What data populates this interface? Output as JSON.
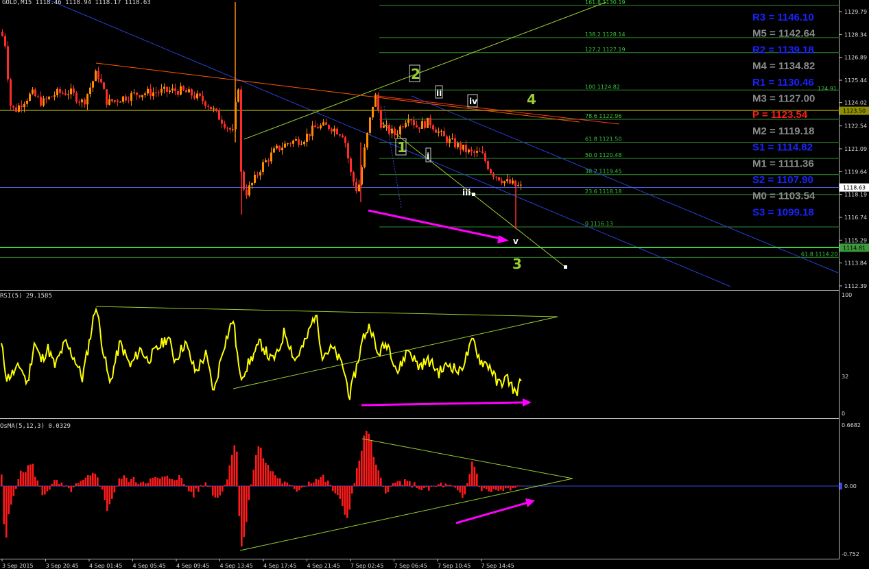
{
  "chart_data": [
    {
      "type": "candlestick",
      "title": "GOLD,M15  1118.46 1118.94 1118.17 1118.63",
      "ylim": [
        1112.0,
        1130.4
      ],
      "price_ticks": [
        "1129.79",
        "1128.34",
        "1126.89",
        "1125.44",
        "1124.02",
        "1122.54",
        "1121.09",
        "1119.64",
        "1118.19",
        "1116.74",
        "1115.29",
        "1113.84",
        "1112.39"
      ],
      "current_price": "1118.63",
      "level_tags": [
        {
          "price": 1123.5,
          "text": "1123.50",
          "color": "#8f8f00"
        },
        {
          "price": 1114.81,
          "text": "1114.81",
          "color": "#3c9a3c"
        }
      ],
      "x_labels": [
        "3 Sep 2015",
        "3 Sep 20:45",
        "4 Sep 01:45",
        "4 Sep 05:45",
        "4 Sep 09:45",
        "4 Sep 13:45",
        "4 Sep 17:45",
        "4 Sep 21:45",
        "7 Sep 02:45",
        "7 Sep 06:45",
        "7 Sep 10:45",
        "7 Sep 14:45"
      ],
      "fib_levels": [
        {
          "label": "161.8  1130.19",
          "price": 1130.19
        },
        {
          "label": "138.2  1128.14",
          "price": 1128.14
        },
        {
          "label": "127.2  1127.19",
          "price": 1127.19
        },
        {
          "label": "100  1124.82",
          "price": 1124.82
        },
        {
          "label": "78.6  1122.96",
          "price": 1122.96
        },
        {
          "label": "61.8  1121.50",
          "price": 1121.5
        },
        {
          "label": "50.0  1120.48",
          "price": 1120.48
        },
        {
          "label": "38.2  1119.45",
          "price": 1119.45
        },
        {
          "label": "23.6  1118.18",
          "price": 1118.18
        },
        {
          "label": "0  1116.13",
          "price": 1116.13
        }
      ],
      "fib_ext_right": [
        "61.8  1114.20",
        "124.91"
      ],
      "pivots": [
        {
          "label": "R3 = 1146.10",
          "color": "#1a22ff"
        },
        {
          "label": "M5 = 1142.64",
          "color": "#8a8a8a"
        },
        {
          "label": "R2 = 1139.18",
          "color": "#1a22ff"
        },
        {
          "label": "M4 = 1134.82",
          "color": "#8a8a8a"
        },
        {
          "label": "R1 = 1130.46",
          "color": "#1a22ff"
        },
        {
          "label": "M3 = 1127.00",
          "color": "#8a8a8a"
        },
        {
          "label": "P  = 1123.54",
          "color": "#ff1a1a"
        },
        {
          "label": "M2 = 1119.18",
          "color": "#8a8a8a"
        },
        {
          "label": "S1 = 1114.82",
          "color": "#1a22ff"
        },
        {
          "label": "M1 = 1111.36",
          "color": "#8a8a8a"
        },
        {
          "label": "S2 = 1107.90",
          "color": "#1a22ff"
        },
        {
          "label": "M0 = 1103.54",
          "color": "#8a8a8a"
        },
        {
          "label": "S3 = 1099.18",
          "color": "#1a22ff"
        }
      ],
      "wave_labels": [
        "2",
        "ii",
        "iv",
        "4",
        "1",
        "i",
        "iii",
        "v",
        "3"
      ],
      "bull_color": "#ff8c00",
      "bear_color": "#ff2a2a"
    },
    {
      "type": "line",
      "title": "RSI(5) 29.1585",
      "ylim": [
        0,
        100
      ],
      "ticks": [
        "100",
        "32",
        "0"
      ],
      "color": "#ffff00"
    },
    {
      "type": "bar",
      "title": "OsMA(5,12,3) 0.0329",
      "ylim": [
        -0.752,
        0.6682
      ],
      "ticks": [
        "0.6682",
        "0.00",
        "-0.752"
      ],
      "color": "#ff1a1a"
    }
  ]
}
